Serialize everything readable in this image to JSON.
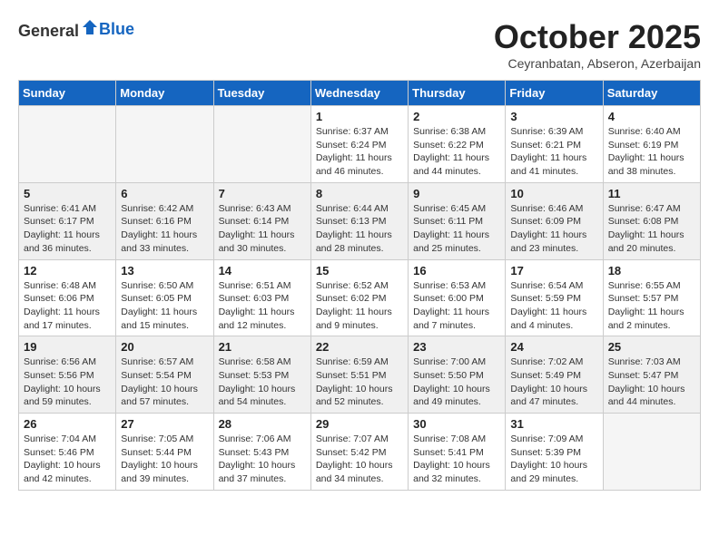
{
  "header": {
    "logo_general": "General",
    "logo_blue": "Blue",
    "month": "October 2025",
    "location": "Ceyranbatan, Abseron, Azerbaijan"
  },
  "weekdays": [
    "Sunday",
    "Monday",
    "Tuesday",
    "Wednesday",
    "Thursday",
    "Friday",
    "Saturday"
  ],
  "weeks": [
    [
      {
        "day": "",
        "info": ""
      },
      {
        "day": "",
        "info": ""
      },
      {
        "day": "",
        "info": ""
      },
      {
        "day": "1",
        "info": "Sunrise: 6:37 AM\nSunset: 6:24 PM\nDaylight: 11 hours\nand 46 minutes."
      },
      {
        "day": "2",
        "info": "Sunrise: 6:38 AM\nSunset: 6:22 PM\nDaylight: 11 hours\nand 44 minutes."
      },
      {
        "day": "3",
        "info": "Sunrise: 6:39 AM\nSunset: 6:21 PM\nDaylight: 11 hours\nand 41 minutes."
      },
      {
        "day": "4",
        "info": "Sunrise: 6:40 AM\nSunset: 6:19 PM\nDaylight: 11 hours\nand 38 minutes."
      }
    ],
    [
      {
        "day": "5",
        "info": "Sunrise: 6:41 AM\nSunset: 6:17 PM\nDaylight: 11 hours\nand 36 minutes."
      },
      {
        "day": "6",
        "info": "Sunrise: 6:42 AM\nSunset: 6:16 PM\nDaylight: 11 hours\nand 33 minutes."
      },
      {
        "day": "7",
        "info": "Sunrise: 6:43 AM\nSunset: 6:14 PM\nDaylight: 11 hours\nand 30 minutes."
      },
      {
        "day": "8",
        "info": "Sunrise: 6:44 AM\nSunset: 6:13 PM\nDaylight: 11 hours\nand 28 minutes."
      },
      {
        "day": "9",
        "info": "Sunrise: 6:45 AM\nSunset: 6:11 PM\nDaylight: 11 hours\nand 25 minutes."
      },
      {
        "day": "10",
        "info": "Sunrise: 6:46 AM\nSunset: 6:09 PM\nDaylight: 11 hours\nand 23 minutes."
      },
      {
        "day": "11",
        "info": "Sunrise: 6:47 AM\nSunset: 6:08 PM\nDaylight: 11 hours\nand 20 minutes."
      }
    ],
    [
      {
        "day": "12",
        "info": "Sunrise: 6:48 AM\nSunset: 6:06 PM\nDaylight: 11 hours\nand 17 minutes."
      },
      {
        "day": "13",
        "info": "Sunrise: 6:50 AM\nSunset: 6:05 PM\nDaylight: 11 hours\nand 15 minutes."
      },
      {
        "day": "14",
        "info": "Sunrise: 6:51 AM\nSunset: 6:03 PM\nDaylight: 11 hours\nand 12 minutes."
      },
      {
        "day": "15",
        "info": "Sunrise: 6:52 AM\nSunset: 6:02 PM\nDaylight: 11 hours\nand 9 minutes."
      },
      {
        "day": "16",
        "info": "Sunrise: 6:53 AM\nSunset: 6:00 PM\nDaylight: 11 hours\nand 7 minutes."
      },
      {
        "day": "17",
        "info": "Sunrise: 6:54 AM\nSunset: 5:59 PM\nDaylight: 11 hours\nand 4 minutes."
      },
      {
        "day": "18",
        "info": "Sunrise: 6:55 AM\nSunset: 5:57 PM\nDaylight: 11 hours\nand 2 minutes."
      }
    ],
    [
      {
        "day": "19",
        "info": "Sunrise: 6:56 AM\nSunset: 5:56 PM\nDaylight: 10 hours\nand 59 minutes."
      },
      {
        "day": "20",
        "info": "Sunrise: 6:57 AM\nSunset: 5:54 PM\nDaylight: 10 hours\nand 57 minutes."
      },
      {
        "day": "21",
        "info": "Sunrise: 6:58 AM\nSunset: 5:53 PM\nDaylight: 10 hours\nand 54 minutes."
      },
      {
        "day": "22",
        "info": "Sunrise: 6:59 AM\nSunset: 5:51 PM\nDaylight: 10 hours\nand 52 minutes."
      },
      {
        "day": "23",
        "info": "Sunrise: 7:00 AM\nSunset: 5:50 PM\nDaylight: 10 hours\nand 49 minutes."
      },
      {
        "day": "24",
        "info": "Sunrise: 7:02 AM\nSunset: 5:49 PM\nDaylight: 10 hours\nand 47 minutes."
      },
      {
        "day": "25",
        "info": "Sunrise: 7:03 AM\nSunset: 5:47 PM\nDaylight: 10 hours\nand 44 minutes."
      }
    ],
    [
      {
        "day": "26",
        "info": "Sunrise: 7:04 AM\nSunset: 5:46 PM\nDaylight: 10 hours\nand 42 minutes."
      },
      {
        "day": "27",
        "info": "Sunrise: 7:05 AM\nSunset: 5:44 PM\nDaylight: 10 hours\nand 39 minutes."
      },
      {
        "day": "28",
        "info": "Sunrise: 7:06 AM\nSunset: 5:43 PM\nDaylight: 10 hours\nand 37 minutes."
      },
      {
        "day": "29",
        "info": "Sunrise: 7:07 AM\nSunset: 5:42 PM\nDaylight: 10 hours\nand 34 minutes."
      },
      {
        "day": "30",
        "info": "Sunrise: 7:08 AM\nSunset: 5:41 PM\nDaylight: 10 hours\nand 32 minutes."
      },
      {
        "day": "31",
        "info": "Sunrise: 7:09 AM\nSunset: 5:39 PM\nDaylight: 10 hours\nand 29 minutes."
      },
      {
        "day": "",
        "info": ""
      }
    ]
  ]
}
